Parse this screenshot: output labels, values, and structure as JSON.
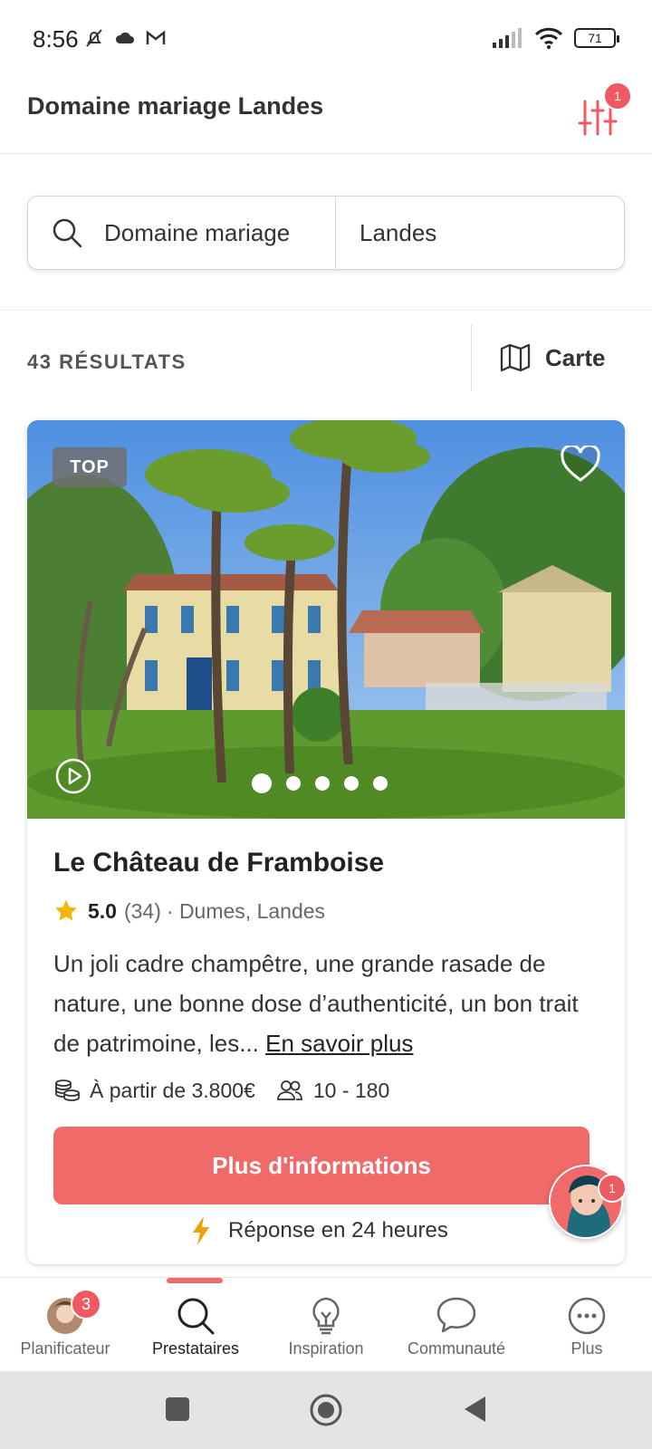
{
  "status_bar": {
    "time": "8:56",
    "battery": "71"
  },
  "header": {
    "title": "Domaine mariage Landes",
    "filter_badge": "1"
  },
  "search": {
    "query": "Domaine mariage",
    "location": "Landes"
  },
  "results": {
    "count_label": "43 RÉSULTATS",
    "map_label": "Carte"
  },
  "card": {
    "badge": "TOP",
    "name": "Le Château de Framboise",
    "rating": "5.0",
    "reviews": "(34)",
    "location": "· Dumes, Landes",
    "description": "Un joli cadre champêtre, une grande rasade de nature, une bonne dose d’authenticité, un bon trait de patrimoine, les...",
    "more_link": "En savoir plus",
    "price": "À partir de 3.800€",
    "capacity": "10 - 180",
    "cta": "Plus d'informations",
    "response": "Réponse en 24 heures",
    "photo_count": 5,
    "photo_index": 1
  },
  "assistant_badge": "1",
  "bottom_nav": {
    "items": [
      {
        "label": "Planificateur",
        "badge": "3"
      },
      {
        "label": "Prestataires"
      },
      {
        "label": "Inspiration"
      },
      {
        "label": "Communauté"
      },
      {
        "label": "Plus"
      }
    ],
    "active": "Prestataires"
  },
  "colors": {
    "accent": "#f06a6a",
    "badge": "#ef5a62",
    "star": "#f5b400",
    "bolt": "#e8a400"
  }
}
